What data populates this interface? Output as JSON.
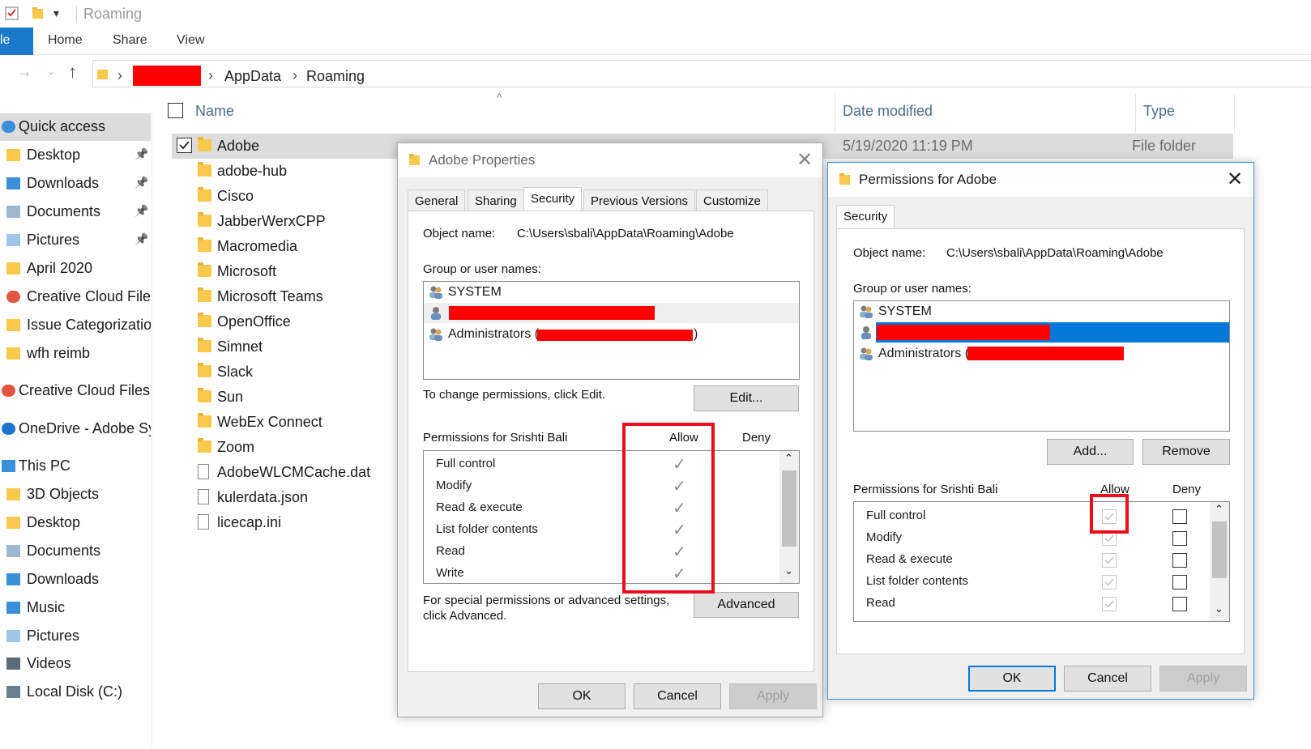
{
  "explorer": {
    "window_title": "Roaming",
    "ribbon": {
      "file_tab": "le",
      "tabs": [
        "Home",
        "Share",
        "View"
      ]
    },
    "address": {
      "segments": [
        "AppData",
        "Roaming"
      ]
    },
    "nav": {
      "items": [
        {
          "label": "Quick access",
          "icon": "star-icon"
        },
        {
          "label": "Desktop",
          "icon": "folder-icon",
          "pinned": true
        },
        {
          "label": "Downloads",
          "icon": "download-folder-icon",
          "pinned": true
        },
        {
          "label": "Documents",
          "icon": "documents-folder-icon",
          "pinned": true
        },
        {
          "label": "Pictures",
          "icon": "pictures-folder-icon",
          "pinned": true
        },
        {
          "label": "April 2020",
          "icon": "folder-icon"
        },
        {
          "label": "Creative Cloud Files",
          "icon": "creative-cloud-icon"
        },
        {
          "label": "Issue Categorizatior",
          "icon": "folder-icon"
        },
        {
          "label": "wfh reimb",
          "icon": "folder-icon"
        },
        {
          "label": "Creative Cloud Files",
          "icon": "creative-cloud-icon"
        },
        {
          "label": "OneDrive - Adobe Sy",
          "icon": "onedrive-icon"
        },
        {
          "label": "This PC",
          "icon": "pc-icon"
        },
        {
          "label": "3D Objects",
          "icon": "folder-icon"
        },
        {
          "label": "Desktop",
          "icon": "folder-icon"
        },
        {
          "label": "Documents",
          "icon": "documents-folder-icon"
        },
        {
          "label": "Downloads",
          "icon": "download-folder-icon"
        },
        {
          "label": "Music",
          "icon": "music-folder-icon"
        },
        {
          "label": "Pictures",
          "icon": "pictures-folder-icon"
        },
        {
          "label": "Videos",
          "icon": "videos-folder-icon"
        },
        {
          "label": "Local Disk (C:)",
          "icon": "disk-icon"
        }
      ]
    },
    "columns": {
      "name": "Name",
      "date_modified": "Date modified",
      "type": "Type"
    },
    "files": [
      {
        "name": "Adobe",
        "date": "5/19/2020 11:19 PM",
        "type": "File folder",
        "kind": "folder",
        "selected": true
      },
      {
        "name": "adobe-hub",
        "kind": "folder"
      },
      {
        "name": "Cisco",
        "kind": "folder"
      },
      {
        "name": "JabberWerxCPP",
        "kind": "folder"
      },
      {
        "name": "Macromedia",
        "kind": "folder"
      },
      {
        "name": "Microsoft",
        "kind": "folder"
      },
      {
        "name": "Microsoft Teams",
        "kind": "folder"
      },
      {
        "name": "OpenOffice",
        "kind": "folder"
      },
      {
        "name": "Simnet",
        "kind": "folder"
      },
      {
        "name": "Slack",
        "kind": "folder"
      },
      {
        "name": "Sun",
        "kind": "folder"
      },
      {
        "name": "WebEx Connect",
        "kind": "folder"
      },
      {
        "name": "Zoom",
        "kind": "folder"
      },
      {
        "name": "AdobeWLCMCache.dat",
        "kind": "file"
      },
      {
        "name": "kulerdata.json",
        "kind": "file"
      },
      {
        "name": "licecap.ini",
        "kind": "file"
      }
    ]
  },
  "properties_dialog": {
    "title": "Adobe Properties",
    "tabs": [
      "General",
      "Sharing",
      "Security",
      "Previous Versions",
      "Customize"
    ],
    "active_tab": "Security",
    "object_name_label": "Object name:",
    "object_name_value": "C:\\Users\\sbali\\AppData\\Roaming\\Adobe",
    "group_label": "Group or user names:",
    "users": [
      "SYSTEM",
      "",
      "Administrators ("
    ],
    "users_suffix": ")",
    "change_hint": "To change permissions, click Edit.",
    "edit_button": "Edit...",
    "permissions_label": "Permissions for Srishti Bali",
    "allow_header": "Allow",
    "deny_header": "Deny",
    "permissions": [
      "Full control",
      "Modify",
      "Read & execute",
      "List folder contents",
      "Read",
      "Write"
    ],
    "special_hint_1": "For special permissions or advanced settings,",
    "special_hint_2": "click Advanced.",
    "advanced_button": "Advanced",
    "ok": "OK",
    "cancel": "Cancel",
    "apply": "Apply"
  },
  "permissions_dialog": {
    "title": "Permissions for Adobe",
    "tab": "Security",
    "object_name_label": "Object name:",
    "object_name_value": "C:\\Users\\sbali\\AppData\\Roaming\\Adobe",
    "group_label": "Group or user names:",
    "users": [
      "SYSTEM",
      "",
      "Administrators ("
    ],
    "add_button": "Add...",
    "remove_button": "Remove",
    "permissions_label": "Permissions for Srishti Bali",
    "allow_header": "Allow",
    "deny_header": "Deny",
    "permissions": [
      "Full control",
      "Modify",
      "Read & execute",
      "List folder contents",
      "Read"
    ],
    "ok": "OK",
    "cancel": "Cancel",
    "apply": "Apply"
  },
  "colors": {
    "accent": "#0078d7",
    "redaction": "#ff0000",
    "highlight_box": "#ea0e1d",
    "selection": "#dcdcdc"
  }
}
